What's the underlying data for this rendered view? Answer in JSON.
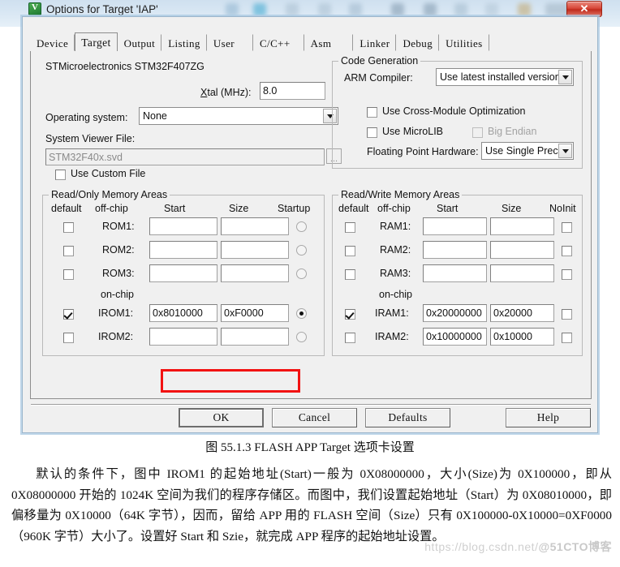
{
  "window": {
    "title": "Options for Target 'IAP'",
    "icon": "keil-uvision-icon",
    "close_label": "✕"
  },
  "tabs": [
    {
      "label": "Device",
      "selected": false
    },
    {
      "label": "Target",
      "selected": true
    },
    {
      "label": "Output",
      "selected": false
    },
    {
      "label": "Listing",
      "selected": false
    },
    {
      "label": "User",
      "selected": false
    },
    {
      "label": "C/C++",
      "selected": false
    },
    {
      "label": "Asm",
      "selected": false
    },
    {
      "label": "Linker",
      "selected": false
    },
    {
      "label": "Debug",
      "selected": false
    },
    {
      "label": "Utilities",
      "selected": false
    }
  ],
  "target": {
    "device_line": "STMicroelectronics STM32F407ZG",
    "xtal_label_pre": "X",
    "xtal_label_post": "tal (MHz):",
    "xtal_value": "8.0",
    "os_label": "Operating system:",
    "os_value": "None",
    "sysviewer_label": "System Viewer File:",
    "sysviewer_value": "STM32F40x.svd",
    "browse_label": "...",
    "use_custom_file_label": "Use Custom File",
    "use_custom_file_checked": false
  },
  "code_generation": {
    "title": "Code Generation",
    "arm_compiler_label": "ARM Compiler:",
    "arm_compiler_value": "Use latest installed version",
    "cross_module_label": "Use Cross-Module Optimization",
    "cross_module_checked": false,
    "microlib_label": "Use MicroLIB",
    "microlib_checked": false,
    "big_endian_label": "Big Endian",
    "big_endian_checked": false,
    "big_endian_disabled": true,
    "fpu_label": "Floating Point Hardware:",
    "fpu_value": "Use Single Precision"
  },
  "read_only": {
    "title": "Read/Only Memory Areas",
    "headers": [
      "default",
      "off-chip",
      "Start",
      "Size",
      "Startup"
    ],
    "onchip_label": "on-chip",
    "rows": [
      {
        "name": "ROM1:",
        "default": false,
        "start": "",
        "size": "",
        "startup": false,
        "onchip": false
      },
      {
        "name": "ROM2:",
        "default": false,
        "start": "",
        "size": "",
        "startup": false,
        "onchip": false
      },
      {
        "name": "ROM3:",
        "default": false,
        "start": "",
        "size": "",
        "startup": false,
        "onchip": false
      },
      {
        "name": "IROM1:",
        "default": true,
        "start": "0x8010000",
        "size": "0xF0000",
        "startup": true,
        "onchip": true
      },
      {
        "name": "IROM2:",
        "default": false,
        "start": "",
        "size": "",
        "startup": false,
        "onchip": true
      }
    ]
  },
  "read_write": {
    "title": "Read/Write Memory Areas",
    "headers": [
      "default",
      "off-chip",
      "Start",
      "Size",
      "NoInit"
    ],
    "onchip_label": "on-chip",
    "rows": [
      {
        "name": "RAM1:",
        "default": false,
        "start": "",
        "size": "",
        "noinit": false
      },
      {
        "name": "RAM2:",
        "default": false,
        "start": "",
        "size": "",
        "noinit": false
      },
      {
        "name": "RAM3:",
        "default": false,
        "start": "",
        "size": "",
        "noinit": false
      },
      {
        "name": "IRAM1:",
        "default": true,
        "start": "0x20000000",
        "size": "0x20000",
        "noinit": false
      },
      {
        "name": "IRAM2:",
        "default": false,
        "start": "0x10000000",
        "size": "0x10000",
        "noinit": false
      }
    ]
  },
  "buttons": {
    "ok": "OK",
    "cancel": "Cancel",
    "defaults": "Defaults",
    "help": "Help"
  },
  "annotation": {
    "highlight_color": "#f21212"
  },
  "document": {
    "caption": "图 55.1.3 FLASH APP Target 选项卡设置",
    "para1": "默认的条件下，图中 IROM1 的起始地址(Start)一般为 0X08000000，大小(Size)为 0X100000，即从 0X08000000 开始的 1024K 空间为我们的程序存储区。而图中，我们设置起始地址（Start）为 0X08010000，即偏移量为 0X10000（64K 字节），因而，留给 APP 用的 FLASH 空间（Size）只有 0X100000-0X10000=0XF0000（960K 字节）大小了。设置好 Start 和 Szie，就完成 APP 程序的起始地址设置。",
    "watermark_url": "https://blog.csdn.net/",
    "watermark_tag": "@51CTO博客"
  }
}
